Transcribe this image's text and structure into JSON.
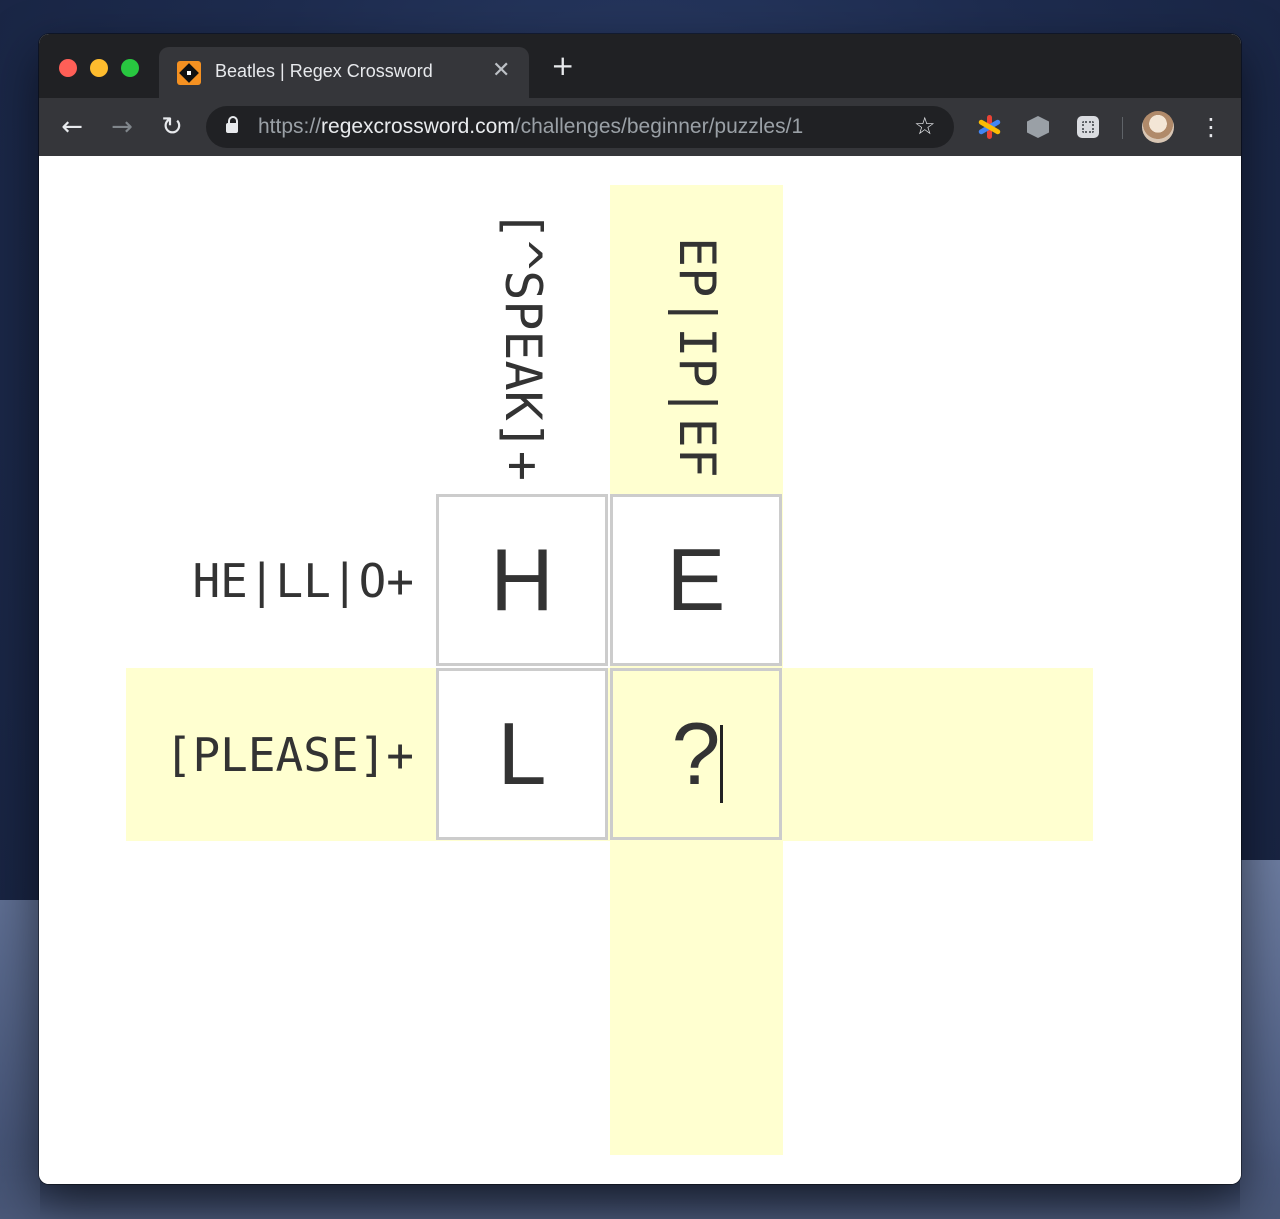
{
  "browser": {
    "tab_title": "Beatles | Regex Crossword",
    "tab_close_glyph": "✕",
    "new_tab_glyph": "+",
    "back_glyph": "←",
    "forward_glyph": "→",
    "reload_glyph": "↻",
    "url_scheme": "https://",
    "url_host": "regexcrossword.com",
    "url_path": "/challenges/beginner/puzzles/1",
    "star_glyph": "☆",
    "menu_glyph": "⋮"
  },
  "puzzle": {
    "column_clues": [
      "[^SPEAK]+",
      "EP|IP|EF"
    ],
    "row_clues": [
      "HE|LL|O+",
      "[PLEASE]+"
    ],
    "cells": [
      [
        "H",
        "E"
      ],
      [
        "L",
        "?"
      ]
    ],
    "highlight_color": "#ffffd0",
    "active_cell": "row 2, column 2"
  }
}
